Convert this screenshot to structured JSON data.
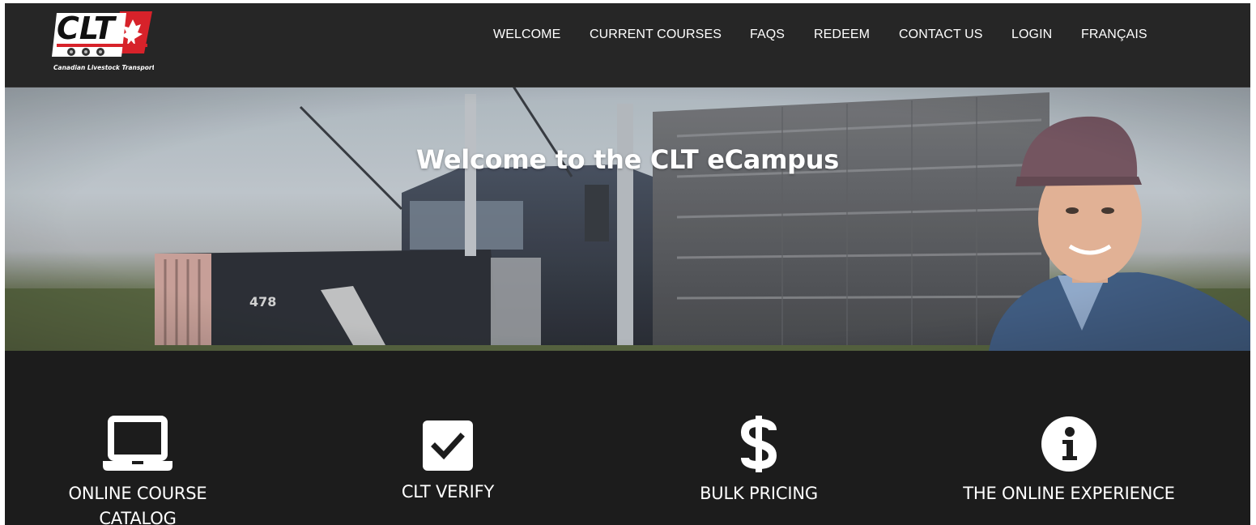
{
  "header": {
    "logo_text": "CLT",
    "logo_subtitle": "Canadian Livestock Transport",
    "nav": [
      {
        "label": "WELCOME"
      },
      {
        "label": "CURRENT COURSES"
      },
      {
        "label": "FAQS"
      },
      {
        "label": "REDEEM"
      },
      {
        "label": "CONTACT US"
      },
      {
        "label": "LOGIN"
      },
      {
        "label": "FRANÇAIS"
      }
    ]
  },
  "hero": {
    "title": "Welcome to the CLT eCampus",
    "truck_number": "478"
  },
  "features": [
    {
      "label": "ONLINE COURSE CATALOG",
      "icon": "laptop-icon"
    },
    {
      "label": "CLT VERIFY",
      "icon": "checkbox-icon"
    },
    {
      "label": "BULK PRICING",
      "icon": "dollar-icon"
    },
    {
      "label": "THE ONLINE EXPERIENCE",
      "icon": "info-icon"
    }
  ],
  "colors": {
    "header_bg": "#262626",
    "page_bg": "#1c1c1c",
    "logo_red": "#d7222a",
    "text": "#ffffff"
  }
}
